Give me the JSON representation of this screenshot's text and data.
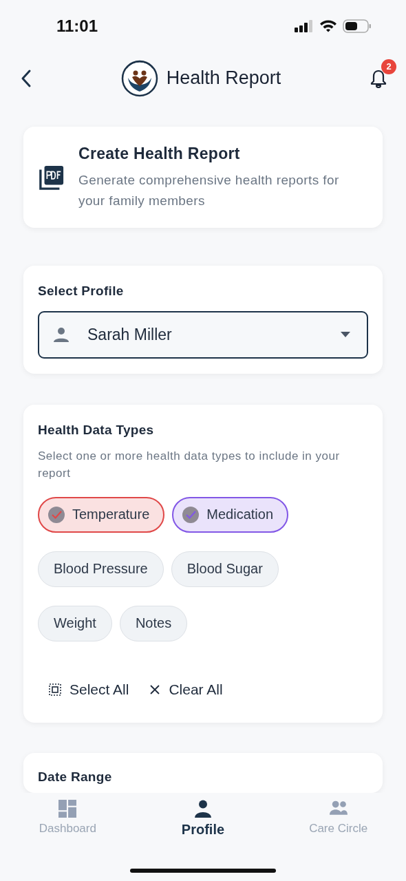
{
  "status_bar": {
    "time": "11:01"
  },
  "header": {
    "title": "Health Report",
    "notification_count": "2"
  },
  "intro_card": {
    "title": "Create Health Report",
    "description": "Generate comprehensive health reports for your family members"
  },
  "profile_card": {
    "label": "Select Profile",
    "value": "Sarah Miller"
  },
  "data_types_card": {
    "title": "Health Data Types",
    "hint": "Select one or more health data types to include in your report",
    "chips": [
      {
        "label": "Temperature",
        "selected": true,
        "color": "#e04848"
      },
      {
        "label": "Medication",
        "selected": true,
        "color": "#8257e6"
      },
      {
        "label": "Blood Pressure",
        "selected": false
      },
      {
        "label": "Blood Sugar",
        "selected": false
      },
      {
        "label": "Weight",
        "selected": false
      },
      {
        "label": "Notes",
        "selected": false
      }
    ],
    "actions": [
      {
        "kind": "select",
        "label": "Select All"
      },
      {
        "kind": "clear",
        "label": "Clear All"
      }
    ]
  },
  "date_card": {
    "title": "Date Range"
  },
  "bottom_nav": [
    {
      "kind": "dashboard",
      "label": "Dashboard",
      "selected": false
    },
    {
      "kind": "profile",
      "label": "Profile",
      "selected": true
    },
    {
      "kind": "people",
      "label": "Care Circle",
      "selected": false
    }
  ]
}
